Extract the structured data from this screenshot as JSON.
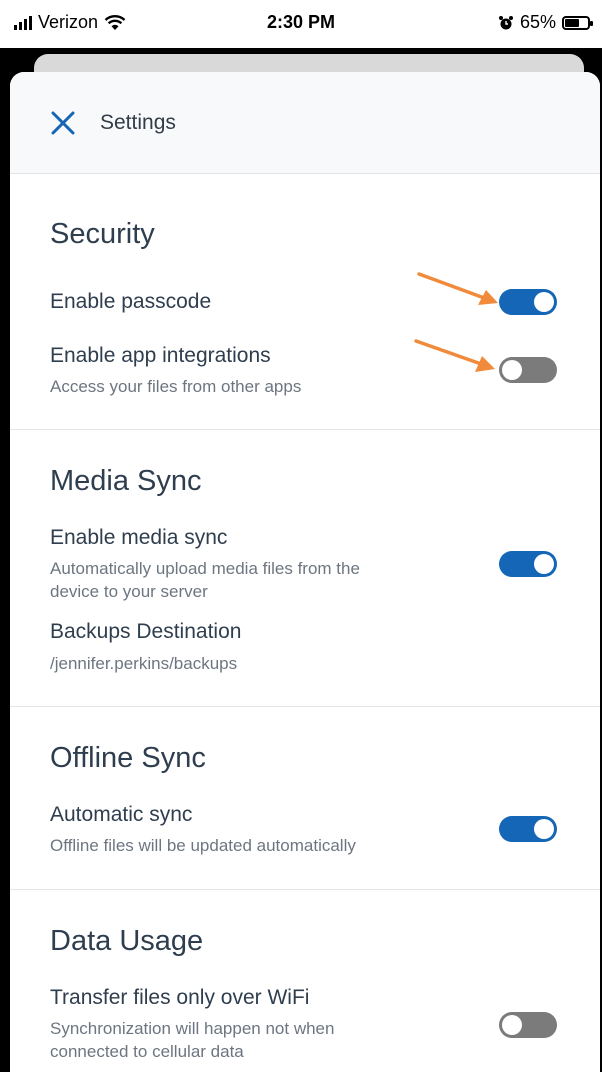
{
  "status_bar": {
    "carrier": "Verizon",
    "time": "2:30 PM",
    "battery": "65%",
    "battery_level": 0.65
  },
  "header": {
    "title": "Settings"
  },
  "sections": {
    "security": {
      "title": "Security",
      "passcode": {
        "label": "Enable passcode",
        "enabled": true
      },
      "integrations": {
        "label": "Enable app integrations",
        "sub": "Access your files from other apps",
        "enabled": false
      }
    },
    "media_sync": {
      "title": "Media Sync",
      "enable": {
        "label": "Enable media sync",
        "sub_line1": "Automatically upload media files from the",
        "sub_line2": "device to your server",
        "enabled": true
      },
      "destination": {
        "label": "Backups Destination",
        "value": "/jennifer.perkins/backups"
      }
    },
    "offline_sync": {
      "title": "Offline Sync",
      "auto": {
        "label": "Automatic sync",
        "sub": "Offline files will be updated automatically",
        "enabled": true
      }
    },
    "data_usage": {
      "title": "Data Usage",
      "wifi": {
        "label": "Transfer files only over WiFi",
        "sub_line1": "Synchronization will happen not when",
        "sub_line2": "connected to cellular data",
        "enabled": false
      }
    }
  },
  "colors": {
    "accent": "#1566b7",
    "annotation_arrow": "#f28a3b",
    "toggle_off": "#7b7b7b"
  }
}
